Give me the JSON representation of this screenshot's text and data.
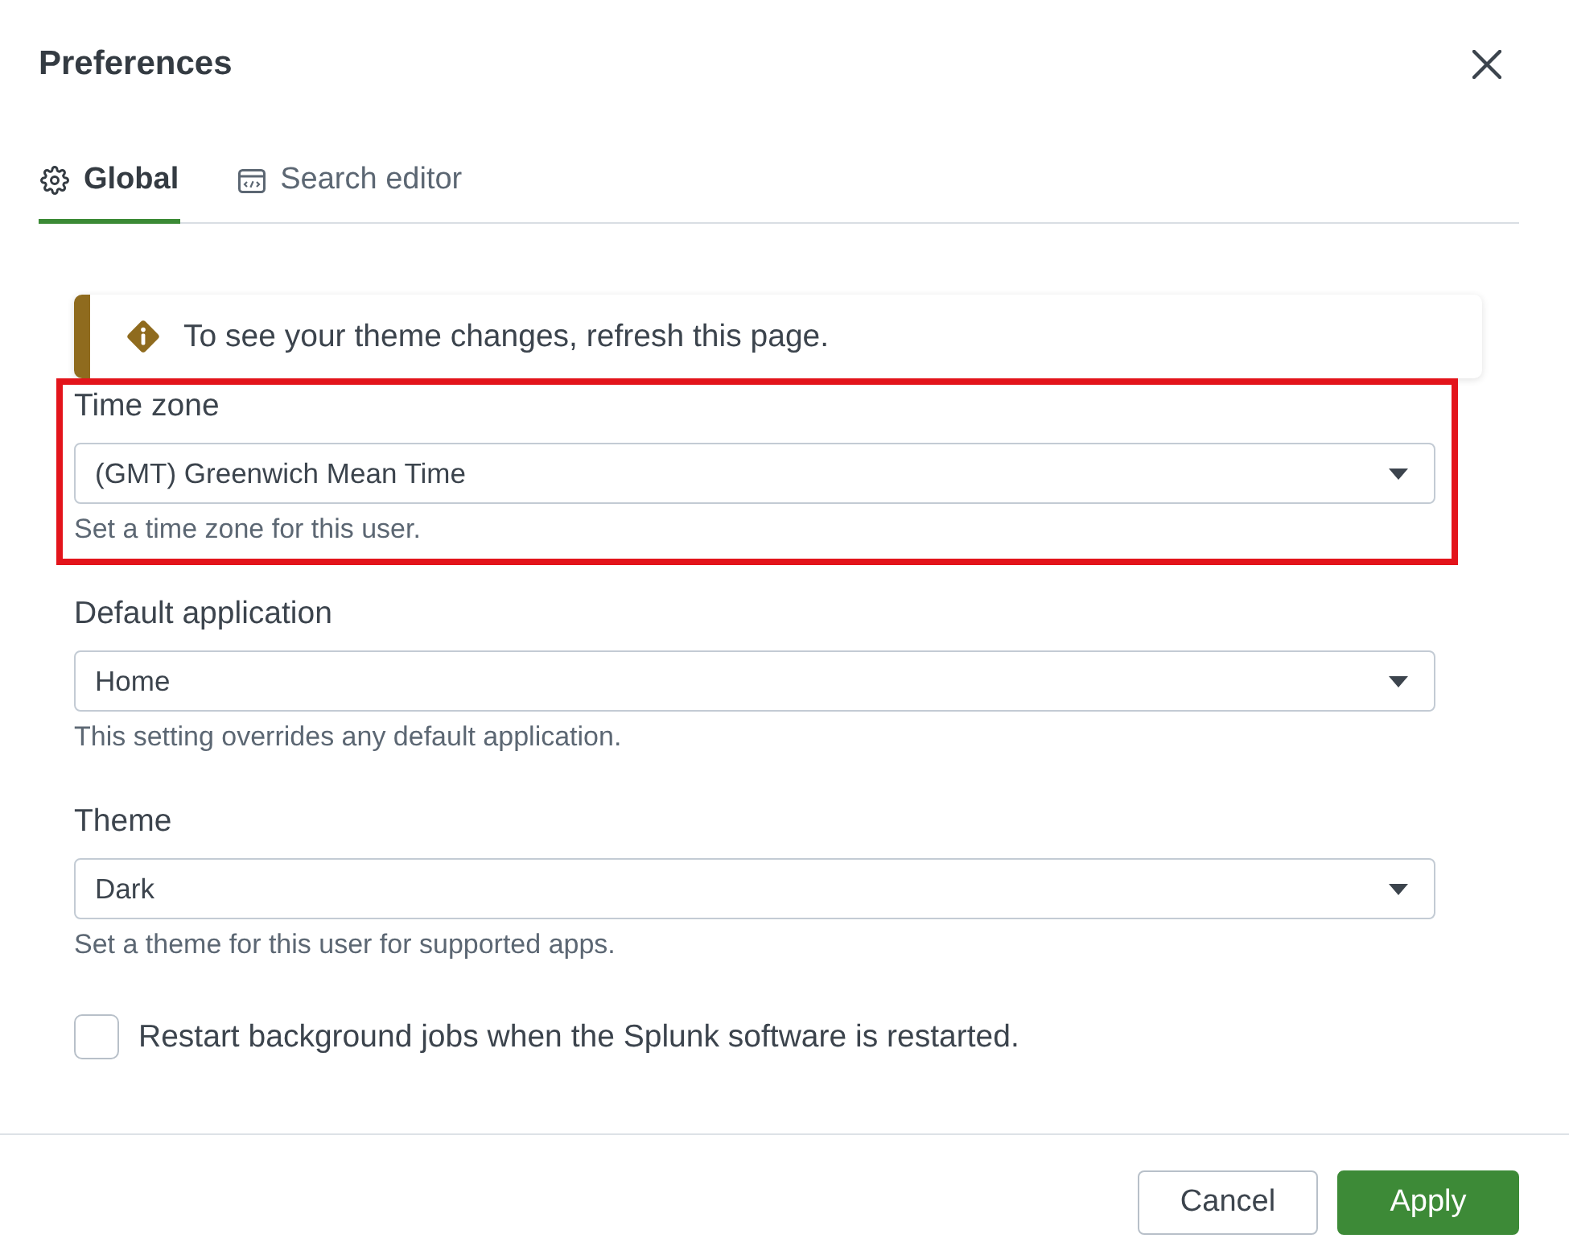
{
  "dialog": {
    "title": "Preferences"
  },
  "tabs": [
    {
      "label": "Global",
      "selected": true,
      "kind": "gear"
    },
    {
      "label": "Search editor",
      "selected": false,
      "kind": "code"
    }
  ],
  "alert": {
    "kind": "warning",
    "message": "To see your theme changes, refresh this page."
  },
  "fields": [
    {
      "label": "Time zone",
      "value": "(GMT) Greenwich Mean Time",
      "help": "Set a time zone for this user.",
      "highlighted": true
    },
    {
      "label": "Default application",
      "value": "Home",
      "help": "This setting overrides any default application.",
      "highlighted": false
    },
    {
      "label": "Theme",
      "value": "Dark",
      "help": "Set a theme for this user for supported apps.",
      "highlighted": false
    }
  ],
  "checkbox": {
    "label": "Restart background jobs when the Splunk software is restarted.",
    "checked": false
  },
  "buttons": [
    {
      "label": "Cancel",
      "kind": "secondary"
    },
    {
      "label": "Apply",
      "kind": "primary"
    }
  ]
}
